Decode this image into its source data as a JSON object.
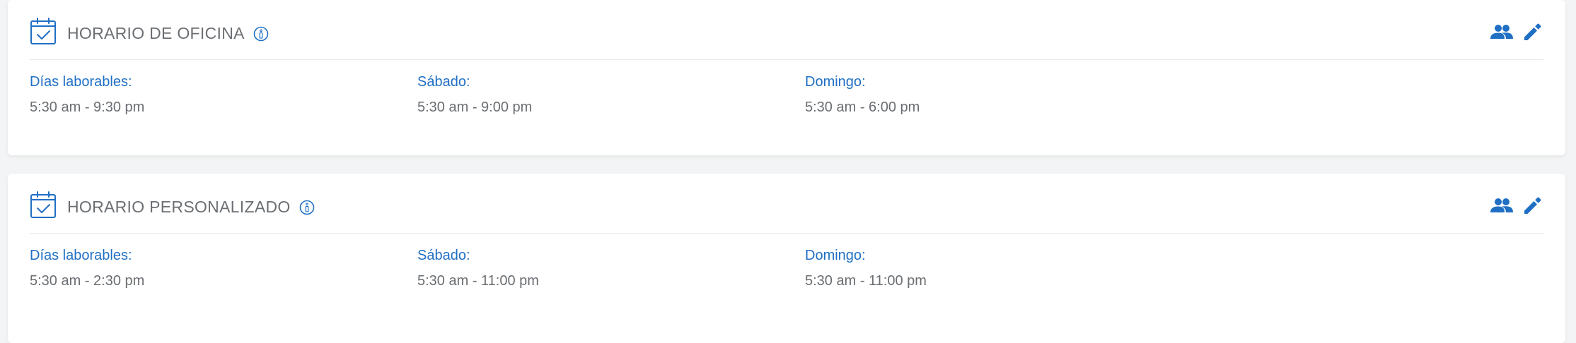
{
  "colors": {
    "accent": "#1f6fc4",
    "title_text": "#6b6f73",
    "value_text": "#6a6e72",
    "divider": "#e6e8ea",
    "page_bg": "#f3f4f5"
  },
  "icons": {
    "header": "calendar-check-icon",
    "info": "info-icon",
    "assign": "users-icon",
    "edit": "pencil-icon"
  },
  "schedules": [
    {
      "title": "HORARIO DE OFICINA",
      "fields": [
        {
          "label": "Días laborables:",
          "value": "5:30 am - 9:30 pm"
        },
        {
          "label": "Sábado:",
          "value": "5:30 am - 9:00 pm"
        },
        {
          "label": "Domingo:",
          "value": "5:30 am - 6:00 pm"
        }
      ]
    },
    {
      "title": "HORARIO PERSONALIZADO",
      "fields": [
        {
          "label": "Días laborables:",
          "value": "5:30 am - 2:30 pm"
        },
        {
          "label": "Sábado:",
          "value": "5:30 am - 11:00 pm"
        },
        {
          "label": "Domingo:",
          "value": "5:30 am - 11:00 pm"
        }
      ]
    }
  ]
}
